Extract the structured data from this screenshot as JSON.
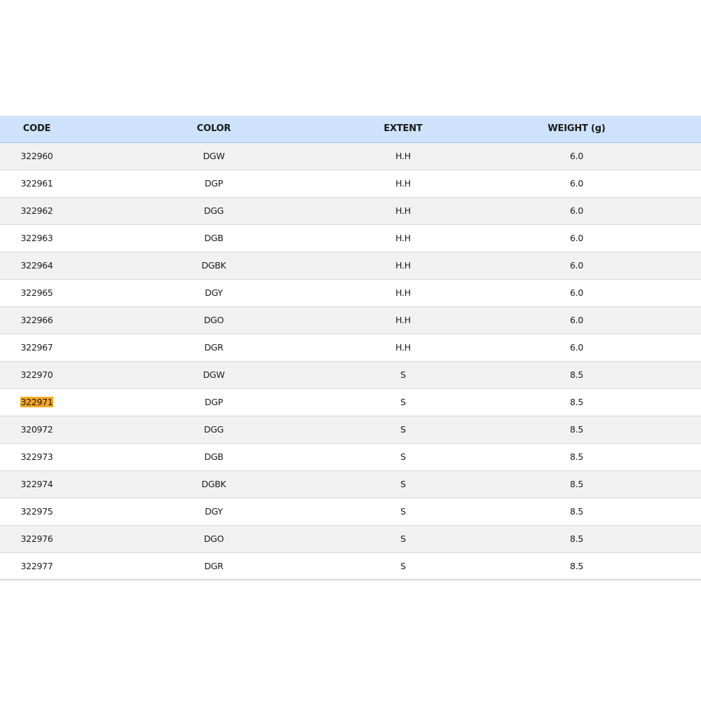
{
  "table": {
    "headers": {
      "code": "CODE",
      "color": "COLOR",
      "extent": "EXTENT",
      "weight": "WEIGHT (g)"
    },
    "highlight_color": "#f5a623",
    "header_background": "#cfe2fb",
    "rows": [
      {
        "code": "322960",
        "color": "DGW",
        "extent": "H.H",
        "weight": "6.0",
        "highlighted": false
      },
      {
        "code": "322961",
        "color": "DGP",
        "extent": "H.H",
        "weight": "6.0",
        "highlighted": false
      },
      {
        "code": "322962",
        "color": "DGG",
        "extent": "H.H",
        "weight": "6.0",
        "highlighted": false
      },
      {
        "code": "322963",
        "color": "DGB",
        "extent": "H.H",
        "weight": "6.0",
        "highlighted": false
      },
      {
        "code": "322964",
        "color": "DGBK",
        "extent": "H.H",
        "weight": "6.0",
        "highlighted": false
      },
      {
        "code": "322965",
        "color": "DGY",
        "extent": "H.H",
        "weight": "6.0",
        "highlighted": false
      },
      {
        "code": "322966",
        "color": "DGO",
        "extent": "H.H",
        "weight": "6.0",
        "highlighted": false
      },
      {
        "code": "322967",
        "color": "DGR",
        "extent": "H.H",
        "weight": "6.0",
        "highlighted": false
      },
      {
        "code": "322970",
        "color": "DGW",
        "extent": "S",
        "weight": "8.5",
        "highlighted": false
      },
      {
        "code": "322971",
        "color": "DGP",
        "extent": "S",
        "weight": "8.5",
        "highlighted": true
      },
      {
        "code": "320972",
        "color": "DGG",
        "extent": "S",
        "weight": "8.5",
        "highlighted": false
      },
      {
        "code": "322973",
        "color": "DGB",
        "extent": "S",
        "weight": "8.5",
        "highlighted": false
      },
      {
        "code": "322974",
        "color": "DGBK",
        "extent": "S",
        "weight": "8.5",
        "highlighted": false
      },
      {
        "code": "322975",
        "color": "DGY",
        "extent": "S",
        "weight": "8.5",
        "highlighted": false
      },
      {
        "code": "322976",
        "color": "DGO",
        "extent": "S",
        "weight": "8.5",
        "highlighted": false
      },
      {
        "code": "322977",
        "color": "DGR",
        "extent": "S",
        "weight": "8.5",
        "highlighted": false
      }
    ]
  }
}
